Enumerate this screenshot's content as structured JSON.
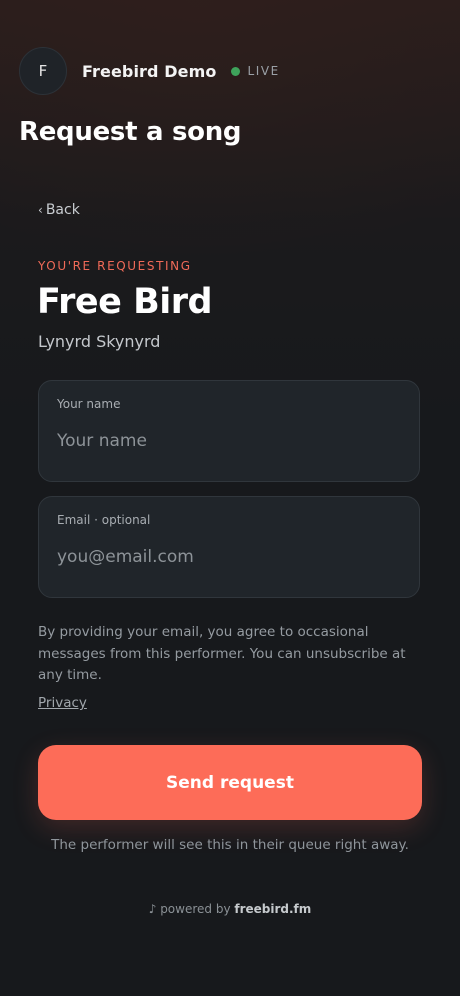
{
  "header": {
    "avatar_initial": "F",
    "performer_name": "Freebird Demo",
    "status_label": "LIVE",
    "status_color": "#3ea35b"
  },
  "page": {
    "title": "Request a song",
    "back_label": "Back"
  },
  "song": {
    "eyebrow": "YOU'RE REQUESTING",
    "title": "Free Bird",
    "artist": "Lynyrd Skynyrd"
  },
  "form": {
    "name_label": "Your name",
    "name_placeholder": "Your name",
    "name_value": "",
    "email_label": "Email · optional",
    "email_placeholder": "you@email.com",
    "email_value": "",
    "consent_text": "By providing your email, you agree to occasional messages from this performer. You can unsubscribe at any time.",
    "privacy_label": "Privacy",
    "submit_label": "Send request",
    "queue_note": "The performer will see this in their queue right away."
  },
  "footer": {
    "note_icon": "music-note-icon",
    "powered_by": "powered by",
    "brand": "freebird.fm"
  },
  "colors": {
    "accent": "#fd6c58",
    "eyebrow": "#f06a58",
    "background": "#17191c"
  }
}
